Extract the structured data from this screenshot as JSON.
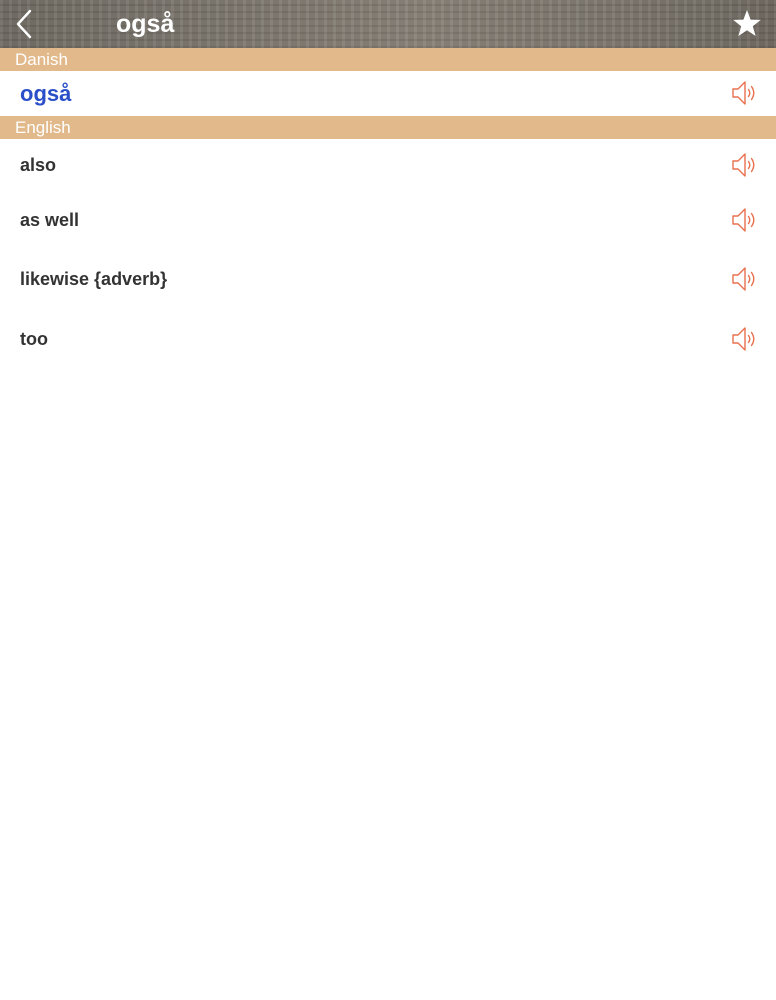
{
  "nav": {
    "title": "også",
    "back_icon": "chevron-left-icon",
    "favorite_icon": "star-icon"
  },
  "source_section": {
    "header": "Danish",
    "word": "også"
  },
  "target_section": {
    "header": "English",
    "translations": [
      "also",
      "as well",
      "likewise {adverb}",
      "too"
    ]
  },
  "colors": {
    "section_header": "#e2b98a",
    "source_word": "#2a4fc9",
    "speaker_icon": "#e8704e",
    "text": "#333333"
  },
  "icons": {
    "speaker": "speaker-icon"
  }
}
